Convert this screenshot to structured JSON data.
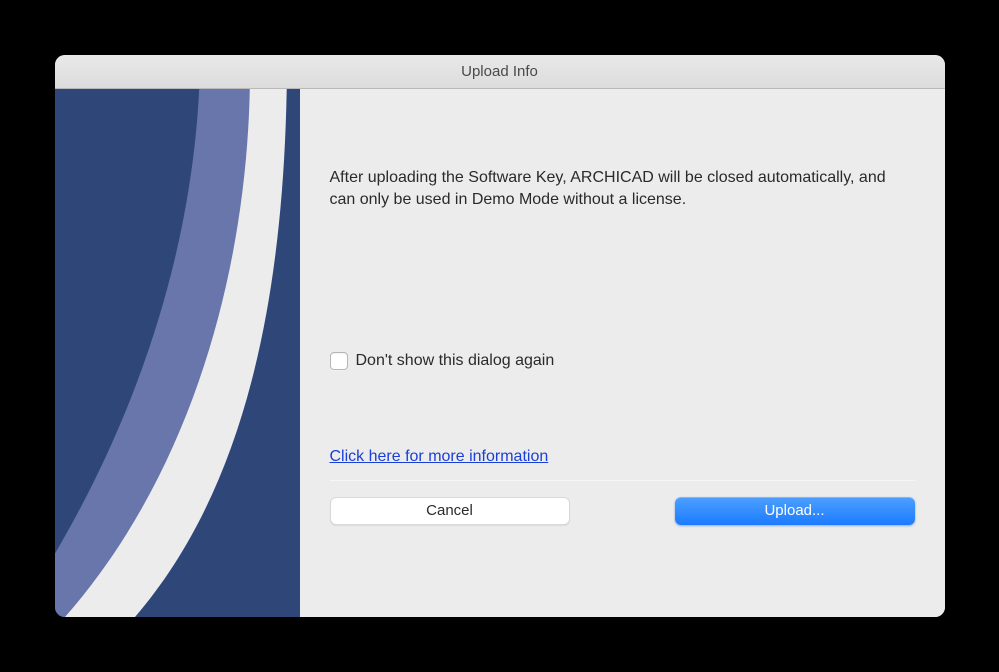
{
  "dialog": {
    "title": "Upload Info",
    "message": "After uploading the Software Key, ARCHICAD will be closed automatically, and can only be used in Demo Mode without a license.",
    "checkbox_label": "Don't show this dialog again",
    "info_link_label": "Click here for more information",
    "buttons": {
      "cancel": "Cancel",
      "upload": "Upload..."
    }
  }
}
